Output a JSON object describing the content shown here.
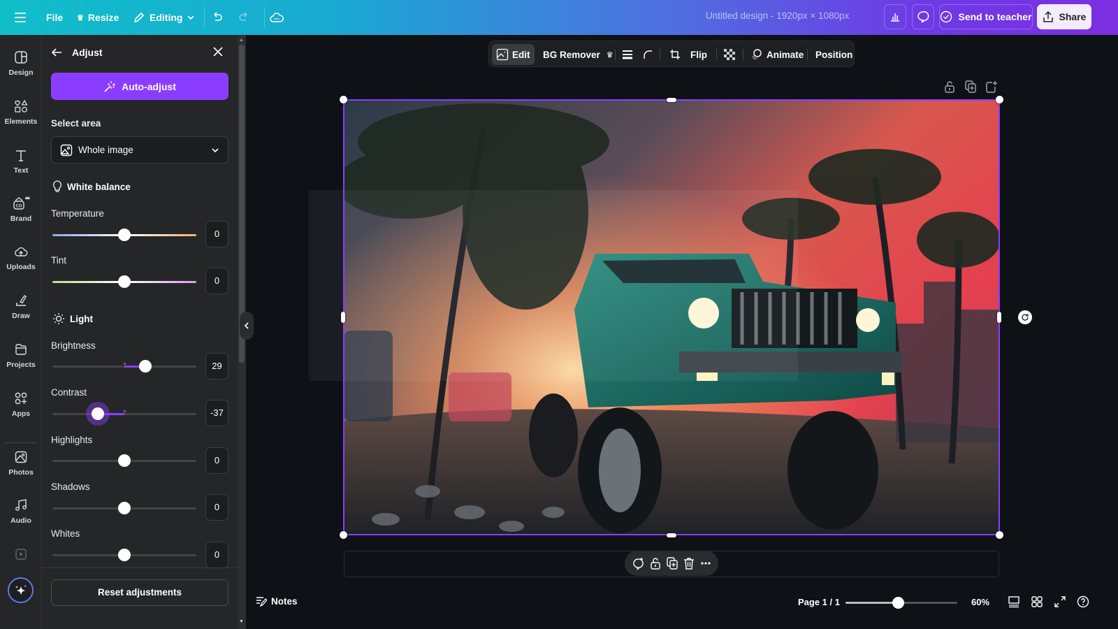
{
  "topbar": {
    "menu_icon": "hamburger-icon",
    "file": "File",
    "resize": "Resize",
    "editing": "Editing",
    "title": "Untitled design - 1920px × 1080px",
    "send_to_teacher": "Send to teacher",
    "share": "Share",
    "colors": {
      "gradient_start": "#10bfc9",
      "gradient_end": "#7b2fe0"
    }
  },
  "rail": {
    "items": [
      {
        "label": "Design",
        "icon": "design-icon"
      },
      {
        "label": "Elements",
        "icon": "elements-icon"
      },
      {
        "label": "Text",
        "icon": "text-icon"
      },
      {
        "label": "Brand",
        "icon": "brand-icon"
      },
      {
        "label": "Uploads",
        "icon": "uploads-icon"
      },
      {
        "label": "Draw",
        "icon": "draw-icon"
      },
      {
        "label": "Projects",
        "icon": "projects-icon"
      },
      {
        "label": "Apps",
        "icon": "apps-icon"
      },
      {
        "label": "Photos",
        "icon": "photos-icon"
      },
      {
        "label": "Audio",
        "icon": "audio-icon"
      }
    ]
  },
  "panel": {
    "title": "Adjust",
    "auto_adjust": "Auto-adjust",
    "select_area_label": "Select area",
    "select_area_value": "Whole image",
    "white_balance": "White balance",
    "light": "Light",
    "sliders": [
      {
        "label": "Temperature",
        "value": "0",
        "fraction": 0.5
      },
      {
        "label": "Tint",
        "value": "0",
        "fraction": 0.5
      },
      {
        "label": "Brightness",
        "value": "29",
        "fraction": 0.645
      },
      {
        "label": "Contrast",
        "value": "-37",
        "fraction": 0.315
      },
      {
        "label": "Highlights",
        "value": "0",
        "fraction": 0.5
      },
      {
        "label": "Shadows",
        "value": "0",
        "fraction": 0.5
      },
      {
        "label": "Whites",
        "value": "0",
        "fraction": 0.5
      }
    ],
    "reset": "Reset adjustments",
    "accent": "#8b3dff"
  },
  "context_toolbar": {
    "edit": "Edit",
    "bg_remover": "BG Remover",
    "flip": "Flip",
    "animate": "Animate",
    "position": "Position"
  },
  "footer": {
    "notes": "Notes",
    "page": "Page 1 / 1",
    "zoom_label": "60%",
    "zoom_fraction": 0.47
  }
}
